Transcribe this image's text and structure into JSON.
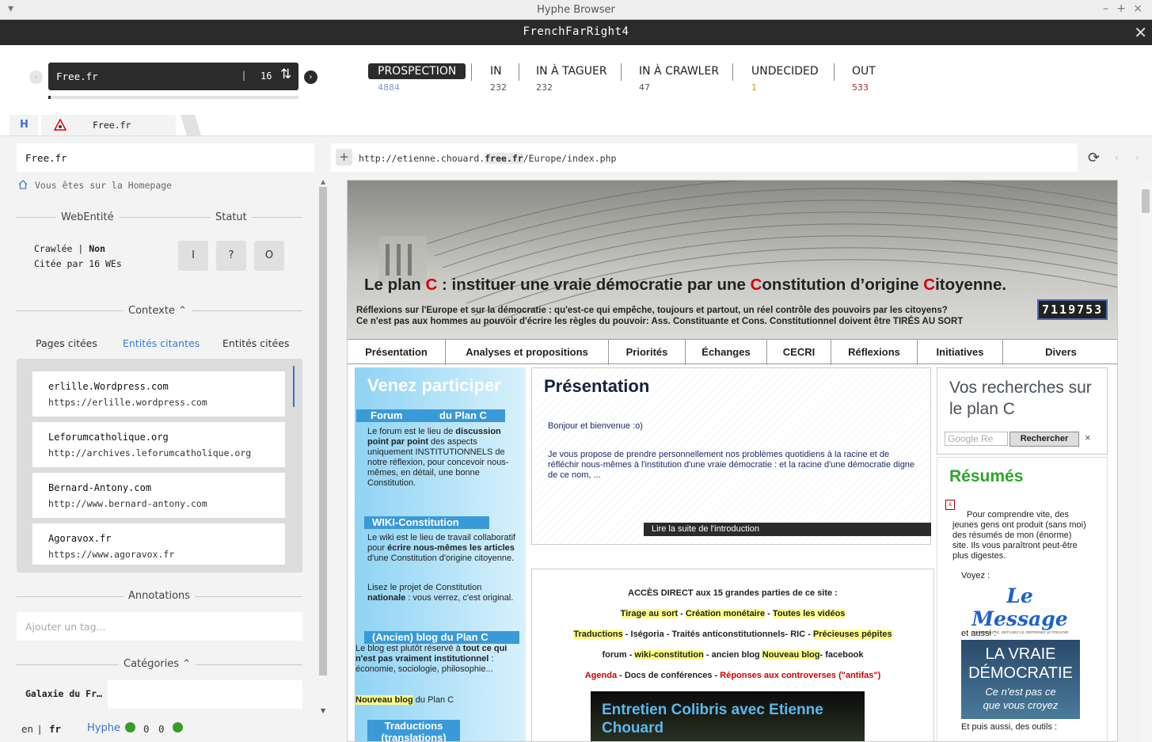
{
  "window": {
    "title": "Hyphe Browser",
    "corpus": "FrenchFarRight4"
  },
  "search": {
    "value": "Free.fr",
    "count": "16"
  },
  "status_tabs": [
    {
      "label": "PROSPECTION",
      "count": "4884",
      "color": "#7a9ec7"
    },
    {
      "label": "IN",
      "count": "232",
      "color": "#555"
    },
    {
      "label": "IN À TAGUER",
      "count": "232",
      "color": "#555"
    },
    {
      "label": "IN À CRAWLER",
      "count": "47",
      "color": "#555"
    },
    {
      "label": "UNDECIDED",
      "count": "1",
      "color": "#c89a2a"
    },
    {
      "label": "OUT",
      "count": "533",
      "color": "#b02a2a"
    }
  ],
  "tabs": {
    "home": "H",
    "site": "Free.fr"
  },
  "left": {
    "entity_name": "Free.fr",
    "homepage_note": "Vous êtes sur la Homepage",
    "webentity_title": "WebEntité",
    "statut_title": "Statut",
    "crawled_label": "Crawlée",
    "crawled_value": "Non",
    "cited_by": "Citée par 16 WEs",
    "status_buttons": [
      "I",
      "?",
      "O"
    ],
    "contexte_title": "Contexte",
    "context_tabs": [
      "Pages citées",
      "Entités citantes",
      "Entités citées"
    ],
    "entities": [
      {
        "name": "erlille.Wordpress.com",
        "url": "https://erlille.wordpress.com"
      },
      {
        "name": "Leforumcatholique.org",
        "url": "http://archives.leforumcatholique.org"
      },
      {
        "name": "Bernard-Antony.com",
        "url": "http://www.bernard-antony.com"
      },
      {
        "name": "Agoravox.fr",
        "url": "https://www.agoravox.fr"
      }
    ],
    "annotations_title": "Annotations",
    "tag_placeholder": "Ajouter un tag...",
    "categories_title": "Catégories",
    "category_label": "Galaxie du Fr…",
    "lang_en": "en",
    "lang_fr": "fr",
    "hyphe": "Hyphe",
    "counters": [
      "0",
      "0"
    ]
  },
  "browser": {
    "url_prefix": "http://etienne.chouard.",
    "url_domain": "free.fr",
    "url_suffix": "/Europe/index.php"
  },
  "page": {
    "banner_title_1": "Le plan ",
    "banner_c": "C",
    "banner_title_2": " : instituer une vraie démocratie par une ",
    "banner_title_3": "onstitution d’origine ",
    "banner_title_4": "itoyenne.",
    "banner_sub1": "Réflexions sur l'Europe et sur la démocratie : qu'est-ce qui empêche, toujours et partout, un réel contrôle des pouvoirs par les citoyens?",
    "banner_sub2": "Ce n'est pas aux hommes au pouvoir d'écrire les règles du pouvoir: Ass. Constituante et Cons. Constitutionnel doivent être TIRÉS AU SORT",
    "counter": "7119753",
    "nav": [
      "Présentation",
      "Analyses et propositions",
      "Priorités",
      "Échanges",
      "CECRI",
      "Réflexions",
      "Initiatives",
      "Divers"
    ],
    "left_col": {
      "title": "Venez participer",
      "forum_h1": "Forum",
      "forum_h2": "du Plan C",
      "forum_t1": "Le forum est le lieu de ",
      "forum_b1": "discussion point par point",
      "forum_t2": " des aspects uniquement INSTITUTIONNELS de notre réflexion, pour concevoir nous-mêmes, en détail, une bonne Constitution.",
      "wiki_h": "WIKI-Constitution",
      "wiki_t1": "Le wiki est le lieu de travail collaboratif pour ",
      "wiki_b1": "écrire nous-mêmes les articles",
      "wiki_t2": " d'une Constitution d'origine citoyenne.",
      "wiki_t3": "Lisez le projet de Constitution ",
      "wiki_b2": "nationale",
      "wiki_t4": " : vous verrez, c'est original.",
      "blog_h": "(Ancien) blog du Plan C",
      "blog_t1": "Le blog est plutôt réservé à ",
      "blog_b1": "tout ce qui n'est pas vraiment institutionnel",
      "blog_t2": " : économie, sociologie, philosophie...",
      "blog_new_b": "Nouveau blog",
      "blog_new_t": " du Plan C",
      "trad": "Traductions (translations)"
    },
    "center": {
      "title": "Présentation",
      "hello": "Bonjour et bienvenue :o)",
      "intro": "Je vous propose de prendre personnellement nos problèmes quotidiens à la racine et de réfléchir nous-mêmes à l'institution d'une vraie démocratie : et la racine d'une démocratie digne de ce nom, ...",
      "read_more": "Lire la suite de l'introduction",
      "access_title": "ACCÈS DIRECT aux 15 grandes parties de ce site :",
      "l1": [
        "Tirage au sort",
        " - ",
        "Création monétaire",
        " - ",
        "Toutes les vidéos"
      ],
      "l2": [
        "Traductions",
        " - Iségoria - Traités anticonstitutionnels- RIC - ",
        "Précieuses pépites"
      ],
      "l3": [
        "forum - ",
        "wiki-constitution",
        " - ancien blog  ",
        "Nouveau blog",
        "- facebook"
      ],
      "l4": [
        "Agenda",
        " - Docs de conférences - ",
        "Réponses aux controverses (\"antifas\")"
      ],
      "video_title": "Entretien Colibris avec Etienne Chouard"
    },
    "right_col": {
      "search_title": "Vos recherches sur le plan C",
      "google": "Google",
      "search_btn": "Rechercher",
      "resumes_title": "Résumés",
      "resumes_text": "Pour comprendre vite, des jeunes gens ont produit (sans moi) des résumés de mon (énorme) site. Ils vous paraîtront peut-être plus digestes.",
      "voyez": "Voyez :",
      "le_message": "Le Message",
      "le_message_sub": "COMPRENEZ LE, DIFFUSEZ LE, REPRENEZ LE POUVOIR",
      "et_aussi": "et aussi :",
      "vraie1": "LA VRAIE",
      "vraie2": "DÉMOCRATIE",
      "vraie3": "Ce n'est pas ce",
      "vraie4": "que vous croyez",
      "outils": "Et puis aussi, des outils :"
    }
  }
}
